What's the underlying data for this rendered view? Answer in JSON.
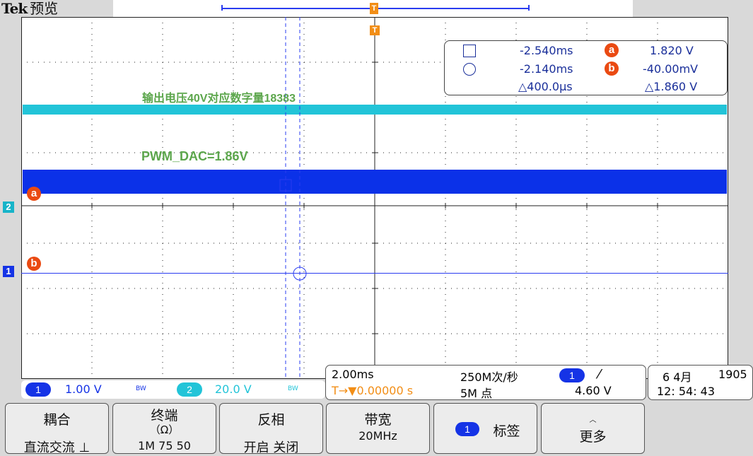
{
  "header": {
    "brand": "Tek",
    "mode": "预览"
  },
  "trigger_marker_label": "T",
  "annotations": {
    "line1": "输出电压40V对应数字量18383",
    "line2": "PWM_DAC=1.86V"
  },
  "channel_markers": {
    "ch2": "2",
    "ch1": "1",
    "cursor_a": "a",
    "cursor_b": "b"
  },
  "cursor_readout": {
    "row1": {
      "time": "-2.540ms",
      "bullet": "a",
      "value": "1.820 V"
    },
    "row2": {
      "time": "-2.140ms",
      "bullet": "b",
      "value": "-40.00mV"
    },
    "row3": {
      "time": "△400.0µs",
      "value": "△1.860 V"
    }
  },
  "status": {
    "ch1": {
      "num": "1",
      "scale": "1.00 V",
      "bw": "BW"
    },
    "ch2": {
      "num": "2",
      "scale": "20.0 V",
      "bw": "BW"
    },
    "timebase": "2.00ms",
    "trigger_pos": "T→▼0.00000 s",
    "sample_rate": "250M次/秒",
    "record_length": "5M 点",
    "trig_source": "1",
    "trig_slope": "⁄",
    "trig_level": "4.60 V",
    "date": "6 4月",
    "year": "1905",
    "time": "12: 54: 43"
  },
  "softkeys": [
    {
      "title": "耦合",
      "value": "直流交流 ⊥"
    },
    {
      "title": "终端",
      "sub": "（Ω）",
      "value": "1M  75  50"
    },
    {
      "title": "反相",
      "value": "开启  关闭"
    },
    {
      "title": "带宽",
      "value": "20MHz"
    },
    {
      "badge": "1",
      "title": "标签"
    },
    {
      "title": "更多"
    }
  ],
  "colors": {
    "ch1": "#1533e6",
    "ch2": "#22c4d8",
    "cursor_marker": "#ea4a12",
    "trigger": "#f28e16",
    "annotation": "#5ca64c"
  }
}
